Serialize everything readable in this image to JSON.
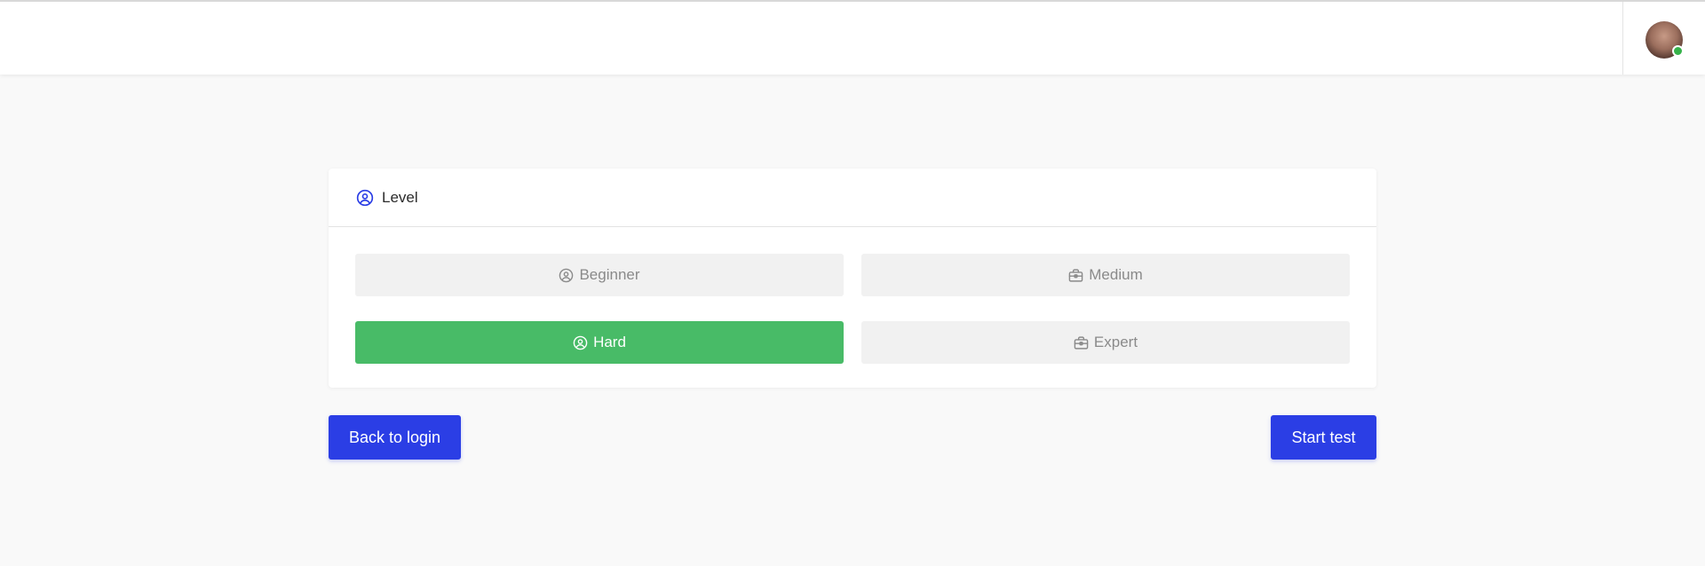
{
  "header": {
    "avatar_alt": "User avatar",
    "status_color": "#36b24a"
  },
  "card": {
    "title": "Level",
    "title_icon": "user-circle-icon",
    "levels": [
      {
        "label": "Beginner",
        "icon": "user-circle-icon",
        "selected": false
      },
      {
        "label": "Medium",
        "icon": "briefcase-icon",
        "selected": false
      },
      {
        "label": "Hard",
        "icon": "user-circle-icon",
        "selected": true
      },
      {
        "label": "Expert",
        "icon": "briefcase-icon",
        "selected": false
      }
    ]
  },
  "actions": {
    "back_label": "Back to login",
    "start_label": "Start test"
  },
  "colors": {
    "accent": "#2b3ee5",
    "selected": "#48bb67",
    "unselected": "#f1f1f1"
  }
}
